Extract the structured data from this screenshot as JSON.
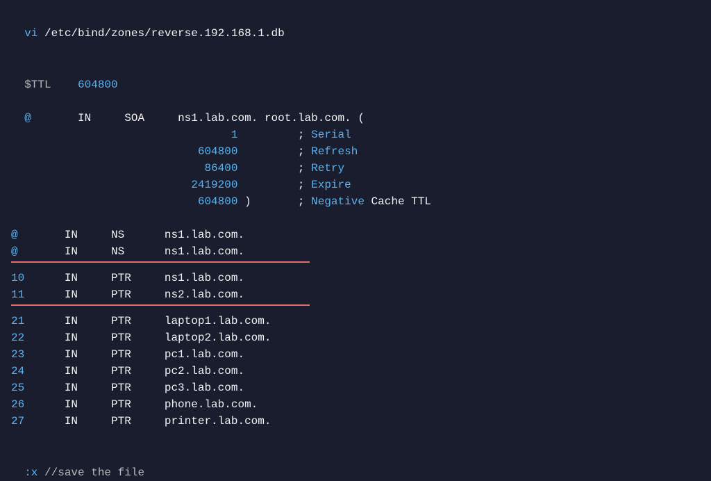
{
  "header": {
    "cmd": "vi",
    "path": "/etc/bind/zones/reverse.192.168.1.db"
  },
  "ttl": {
    "label": "$TTL",
    "value": "604800"
  },
  "soa": {
    "origin": "@",
    "class": "IN",
    "type": "SOA",
    "mname": "ns1.lab.com.",
    "rname": "root.lab.com.",
    "open": "(",
    "params": [
      {
        "value": "1",
        "comment": "Serial",
        "extra": ""
      },
      {
        "value": "604800",
        "comment": "Refresh",
        "extra": ""
      },
      {
        "value": "86400",
        "comment": "Retry",
        "extra": ""
      },
      {
        "value": "2419200",
        "comment": "Expire",
        "extra": ""
      },
      {
        "value": "604800",
        "comment": "Negative",
        "extra": "Cache TTL"
      }
    ],
    "close": ")"
  },
  "ns": [
    {
      "name": "@",
      "class": "IN",
      "type": "NS",
      "target": "ns1.lab.com."
    },
    {
      "name": "@",
      "class": "IN",
      "type": "NS",
      "target": "ns1.lab.com."
    }
  ],
  "ptr_ns": [
    {
      "name": "10",
      "class": "IN",
      "type": "PTR",
      "target": "ns1.lab.com."
    },
    {
      "name": "11",
      "class": "IN",
      "type": "PTR",
      "target": "ns2.lab.com."
    }
  ],
  "ptr_hosts": [
    {
      "name": "21",
      "class": "IN",
      "type": "PTR",
      "target": "laptop1.lab.com."
    },
    {
      "name": "22",
      "class": "IN",
      "type": "PTR",
      "target": "laptop2.lab.com."
    },
    {
      "name": "23",
      "class": "IN",
      "type": "PTR",
      "target": "pc1.lab.com."
    },
    {
      "name": "24",
      "class": "IN",
      "type": "PTR",
      "target": "pc2.lab.com."
    },
    {
      "name": "25",
      "class": "IN",
      "type": "PTR",
      "target": "pc3.lab.com."
    },
    {
      "name": "26",
      "class": "IN",
      "type": "PTR",
      "target": "phone.lab.com."
    },
    {
      "name": "27",
      "class": "IN",
      "type": "PTR",
      "target": "printer.lab.com."
    }
  ],
  "footer": {
    "cmd": ":x",
    "comment": "//save the file"
  },
  "semi": ";"
}
